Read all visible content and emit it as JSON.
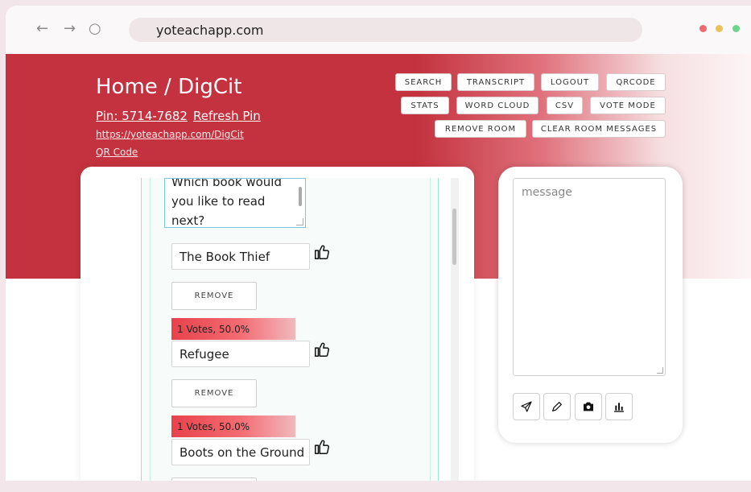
{
  "browser": {
    "url": "yoteachapp.com",
    "back_icon": "←",
    "forward_icon": "→",
    "reload_icon": "○"
  },
  "header": {
    "title": "Home / DigCit",
    "pin": "Pin: 5714-7682",
    "refresh_pin": "Refresh Pin",
    "room_url": "https://yoteachapp.com/DigCit",
    "qr_code": "QR Code"
  },
  "toolbar": {
    "search": "SEARCH",
    "transcript": "TRANSCRIPT",
    "logout": "LOGOUT",
    "qrcode": "QRCODE",
    "stats": "STATS",
    "word_cloud": "WORD CLOUD",
    "csv": "CSV",
    "vote_mode": "VOTE MODE",
    "remove_room": "REMOVE ROOM",
    "clear_room_messages": "CLEAR ROOM MESSAGES"
  },
  "poll": {
    "question": "Which book would you like to read next?",
    "options": [
      {
        "label": "The Book Thief",
        "remove": "REMOVE",
        "votes": "1 Votes, 50.0%"
      },
      {
        "label": "Refugee",
        "remove": "REMOVE",
        "votes": "1 Votes, 50.0%"
      },
      {
        "label": "Boots on the Ground"
      }
    ]
  },
  "chat": {
    "placeholder": "message"
  },
  "colors": {
    "brand_red": "#c3323e",
    "vote_bar": "#e8424b"
  }
}
